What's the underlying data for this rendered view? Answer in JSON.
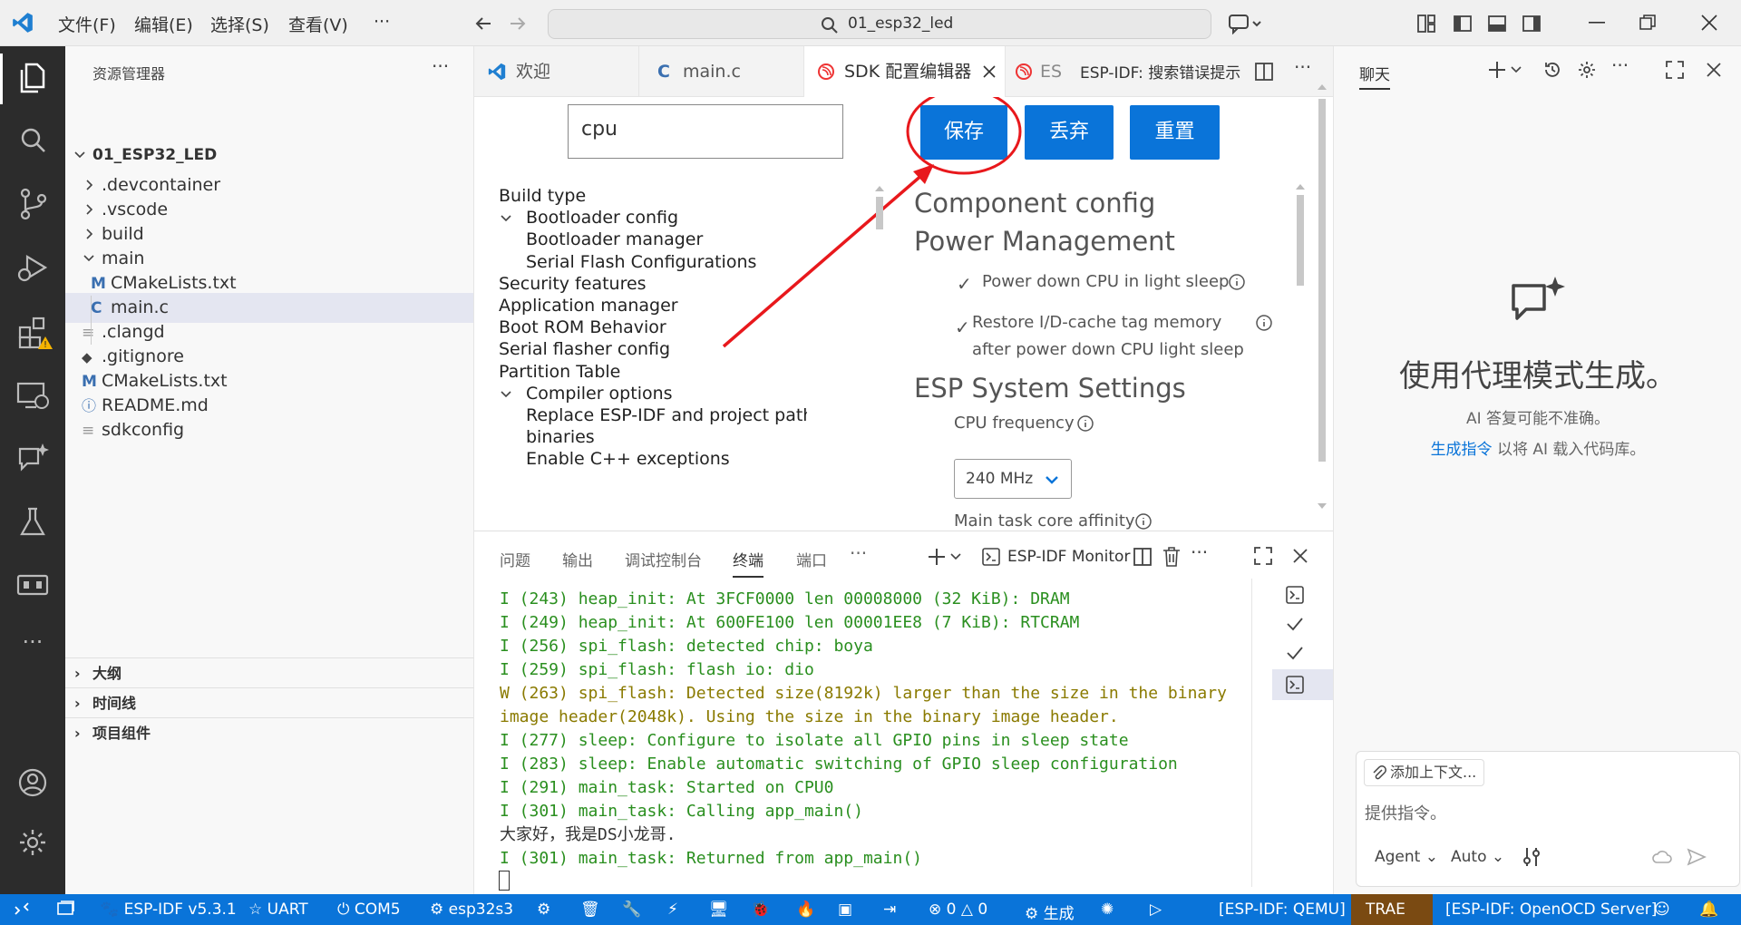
{
  "titlebar": {
    "menus": [
      "文件(F)",
      "编辑(E)",
      "选择(S)",
      "查看(V)",
      "···"
    ],
    "search": "01_esp32_led"
  },
  "sidebar": {
    "title": "资源管理器",
    "root": "01_ESP32_LED",
    "items": [
      {
        "label": ".devcontainer",
        "kind": "folder"
      },
      {
        "label": ".vscode",
        "kind": "folder"
      },
      {
        "label": "build",
        "kind": "folder"
      },
      {
        "label": "main",
        "kind": "folder-open"
      },
      {
        "label": "CMakeLists.txt",
        "kind": "cmake"
      },
      {
        "label": "main.c",
        "kind": "c"
      },
      {
        "label": ".clangd",
        "kind": "text"
      },
      {
        "label": ".gitignore",
        "kind": "git"
      },
      {
        "label": "CMakeLists.txt",
        "kind": "cmake"
      },
      {
        "label": "README.md",
        "kind": "info"
      },
      {
        "label": "sdkconfig",
        "kind": "text"
      }
    ],
    "sections": [
      "大纲",
      "时间线",
      "项目组件"
    ]
  },
  "tabs": [
    {
      "label": "欢迎"
    },
    {
      "label": "main.c"
    },
    {
      "label": "SDK 配置编辑器"
    },
    {
      "label": "ESI"
    },
    {
      "label": "ESP-IDF: 搜索错误提示"
    }
  ],
  "sdk": {
    "search_value": "cpu",
    "save": "保存",
    "discard": "丢弃",
    "reset": "重置",
    "nav": [
      {
        "label": "Build type",
        "level": 0
      },
      {
        "label": "Bootloader config",
        "level": 0,
        "expanded": true
      },
      {
        "label": "Bootloader manager",
        "level": 1
      },
      {
        "label": "Serial Flash Configurations",
        "level": 1
      },
      {
        "label": "Security features",
        "level": 0
      },
      {
        "label": "Application manager",
        "level": 0
      },
      {
        "label": "Boot ROM Behavior",
        "level": 0
      },
      {
        "label": "Serial flasher config",
        "level": 0
      },
      {
        "label": "Partition Table",
        "level": 0
      },
      {
        "label": "Compiler options",
        "level": 0,
        "expanded": true
      },
      {
        "label": "Replace ESP-IDF and project paths in",
        "level": 1
      },
      {
        "label": "binaries",
        "level": 1
      },
      {
        "label": "Enable C++ exceptions",
        "level": 1
      }
    ],
    "component_config": "Component config",
    "power_mgmt": "Power Management",
    "opt1": "Power down CPU in light sleep",
    "opt2_line1": "Restore I/D-cache tag memory",
    "opt2_line2": "after power down CPU light sleep",
    "esp_sys": "ESP System Settings",
    "cpu_freq_label": "CPU frequency",
    "cpu_freq_value": "240 MHz",
    "main_task_label": "Main task core affinity"
  },
  "panel": {
    "tabs": [
      "问题",
      "输出",
      "调试控制台",
      "终端",
      "端口"
    ],
    "more": "···",
    "monitor": "ESP-IDF Monitor",
    "lines": [
      {
        "text": "I (243) heap_init: At 3FCF0000 len 00008000 (32 KiB): DRAM",
        "color": "#2a8f1f"
      },
      {
        "text": "I (249) heap_init: At 600FE100 len 00001EE8 (7 KiB): RTCRAM",
        "color": "#2a8f1f"
      },
      {
        "text": "I (256) spi_flash: detected chip: boya",
        "color": "#2a8f1f"
      },
      {
        "text": "I (259) spi_flash: flash io: dio",
        "color": "#2a8f1f"
      },
      {
        "text": "W (263) spi_flash: Detected size(8192k) larger than the size in the binary",
        "color": "#8a7a00"
      },
      {
        "text": "image header(2048k). Using the size in the binary image header.",
        "color": "#8a7a00"
      },
      {
        "text": "I (277) sleep: Configure to isolate all GPIO pins in sleep state",
        "color": "#2a8f1f"
      },
      {
        "text": "I (283) sleep: Enable automatic switching of GPIO sleep configuration",
        "color": "#2a8f1f"
      },
      {
        "text": "I (291) main_task: Started on CPU0",
        "color": "#2a8f1f"
      },
      {
        "text": "I (301) main_task: Calling app_main()",
        "color": "#2a8f1f"
      },
      {
        "text": "大家好，我是DS小龙哥.",
        "color": "#333333"
      },
      {
        "text": "I (301) main_task: Returned from app_main()",
        "color": "#2a8f1f"
      }
    ]
  },
  "chat": {
    "title": "聊天",
    "heading": "使用代理模式生成。",
    "note": "AI 答复可能不准确。",
    "link": "生成指令",
    "link_suffix": " 以将 AI 载入代码库。",
    "add_context": "添加上下文...",
    "placeholder": "提供指令。",
    "agent": "Agent",
    "auto": "Auto"
  },
  "status": {
    "idf": "ESP-IDF v5.3.1",
    "uart": "UART",
    "com": "COM5",
    "target": "esp32s3",
    "errors": "0",
    "warnings": "0",
    "build": "生成",
    "qemu": "[ESP-IDF: QEMU]",
    "trae": "TRAE",
    "openocd": "[ESP-IDF: OpenOCD Server]"
  },
  "colors": {
    "accent": "#0a74d9",
    "annotation": "#e8181c",
    "activity_bg": "#2c2c2c"
  }
}
